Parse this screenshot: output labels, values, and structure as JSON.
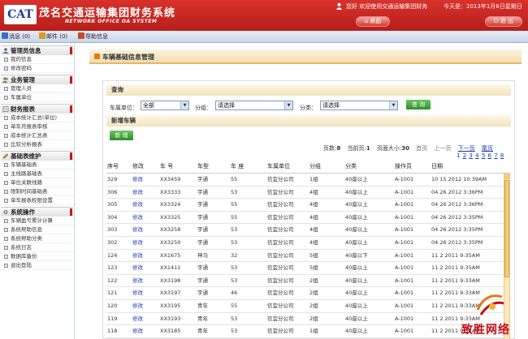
{
  "header": {
    "logo_text": "CAT",
    "title": "茂名交通运输集团财务系统",
    "subtitle": "NETWORK OFFICE OA SYSTEM",
    "welcome": "您好 欢迎使用交通运输集团财务",
    "today": "今天是：2013年1月6日星期日",
    "home_label": "桌面",
    "exit_label": "退  出"
  },
  "topbar": {
    "items": [
      {
        "label": "消息 (0)",
        "icon": "message-icon",
        "color": "#3a6fc4"
      },
      {
        "label": "邮件 (0)",
        "icon": "mail-icon",
        "color": "#d89a2a"
      },
      {
        "label": "帮助信息",
        "icon": "help-icon",
        "color": "#c84a2a"
      }
    ]
  },
  "sidebar": {
    "groups": [
      {
        "title": "管理员信息",
        "items": [
          "我的信息",
          "修改密码"
        ]
      },
      {
        "title": "业务管理",
        "items": [
          "管理人员",
          "车属单位"
        ]
      },
      {
        "title": "财务报表",
        "items": [
          "成本统计汇总(单位)",
          "单车月报表审核",
          "成本统计汇总表",
          "比较分析报表"
        ]
      },
      {
        "title": "基础表维护",
        "items": [
          "车辆基础表",
          "主线路基础表",
          "单位关联线路",
          "限制时间基础表",
          "单车报表权限设置"
        ]
      },
      {
        "title": "系统操作",
        "items": [
          "车辆盈亏累计计算",
          "系统帮助信息",
          "系统帮助分类",
          "系统日志",
          "数据库备份",
          "退出登陆"
        ]
      }
    ]
  },
  "main": {
    "tab_title": "车辆基础信息管理",
    "query_head": "查询",
    "filter_unit_label": "车属单位：",
    "filter_unit_value": "全部",
    "filter_group_label": "分组：",
    "filter_group_value": "请选择",
    "filter_category_label": "分类：",
    "filter_category_value": "请选择",
    "query_button": "查 询",
    "add_head": "新增车辆",
    "add_button": "新 增",
    "pager": {
      "pages_label": "页数:",
      "pages_value": "8",
      "current_label": "当前页:",
      "current_value": "1",
      "size_label": "页面大小:",
      "size_value": "30",
      "first": "首页",
      "prev": "上一页",
      "next": "下一页",
      "last": "尾页",
      "numbers": [
        "1",
        "2",
        "3",
        "4",
        "5",
        "6",
        "7",
        "8"
      ]
    }
  },
  "table": {
    "columns": [
      "序号",
      "修改",
      "车 号",
      "车型",
      "车 座",
      "车属单位",
      "分组",
      "分类",
      "操作员",
      "日期"
    ],
    "rows": [
      [
        "329",
        "修改",
        "XX3459",
        "宇通",
        "55",
        "信宜分公司",
        "1组",
        "40座以上",
        "A-1001",
        "10 15 2012 10:39AM"
      ],
      [
        "306",
        "修改",
        "XX3333",
        "宇通",
        "53",
        "信宜分公司",
        "4组",
        "40座以上",
        "A-1001",
        "04 26 2012 3:36PM"
      ],
      [
        "305",
        "修改",
        "XX3324",
        "宇通",
        "55",
        "信宜分公司",
        "4组",
        "40座以上",
        "A-1001",
        "04 26 2012 3:36PM"
      ],
      [
        "304",
        "修改",
        "XX3325",
        "宇通",
        "55",
        "信宜分公司",
        "4组",
        "40座以上",
        "A-1001",
        "04 26 2012 3:35PM"
      ],
      [
        "303",
        "修改",
        "XX3258",
        "宇通",
        "53",
        "信宜分公司",
        "4组",
        "40座以上",
        "A-1001",
        "04 26 2012 3:35PM"
      ],
      [
        "302",
        "修改",
        "XX3250",
        "宇通",
        "53",
        "信宜分公司",
        "4组",
        "40座以上",
        "A-1001",
        "04 26 2012 3:35PM"
      ],
      [
        "124",
        "修改",
        "XX1675",
        "神马",
        "32",
        "信宜分公司",
        "5组",
        "40座以下",
        "A-1001",
        "11 2 2011 9:35AM"
      ],
      [
        "123",
        "修改",
        "XX1411",
        "宇通",
        "53",
        "信宜分公司",
        "5组",
        "40座以上",
        "A-1001",
        "11 2 2011 9:35AM"
      ],
      [
        "122",
        "修改",
        "XX3198",
        "宇通",
        "53",
        "信宜分公司",
        "2组",
        "40座以上",
        "A-1001",
        "11 2 2011 9:33AM"
      ],
      [
        "121",
        "修改",
        "XX3197",
        "宇通",
        "46",
        "信宜分公司",
        "2组",
        "40座以上",
        "A-1001",
        "11 2 2011 9:33AM"
      ],
      [
        "120",
        "修改",
        "XX3195",
        "青年",
        "55",
        "信宜分公司",
        "2组",
        "40座以上",
        "A-1001",
        "11 2 2011 9:33AM"
      ],
      [
        "119",
        "修改",
        "XX3193",
        "青年",
        "53",
        "信宜分公司",
        "2组",
        "40座以上",
        "A-1001",
        "11 2 2011 9:33AM"
      ],
      [
        "118",
        "修改",
        "XX3185",
        "青年",
        "53",
        "信宜分公司",
        "1组",
        "40座以上",
        "A-1001",
        "11 2 2011 9:33AM"
      ]
    ]
  },
  "watermark": {
    "text": "致胜网络"
  }
}
